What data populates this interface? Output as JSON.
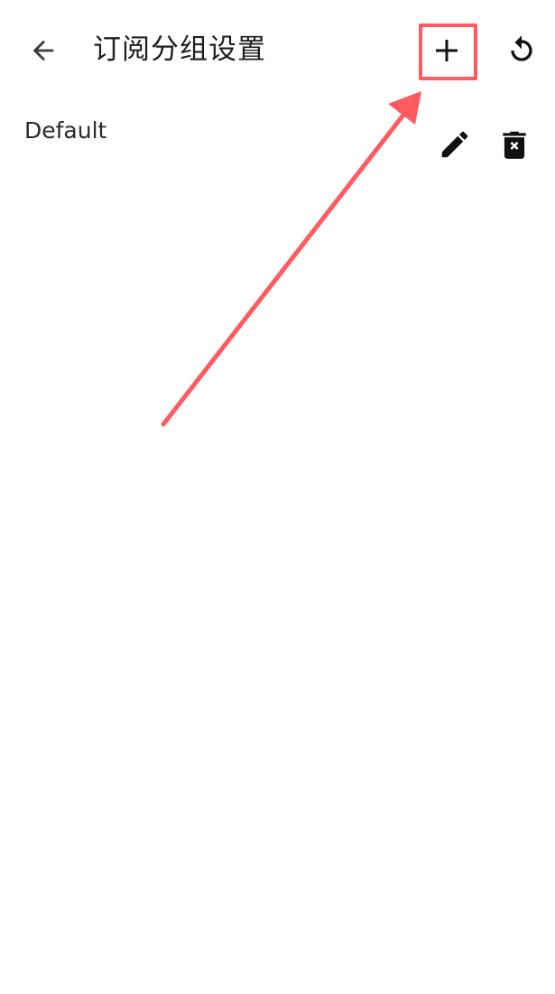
{
  "toolbar": {
    "title": "订阅分组设置",
    "back_icon": "arrow-left-icon",
    "add_icon": "plus-icon",
    "refresh_icon": "refresh-icon"
  },
  "groups": [
    {
      "name": "Default",
      "edit_icon": "pencil-icon",
      "delete_icon": "trash-icon"
    }
  ],
  "colors": {
    "annotation": "#ff5a5f",
    "text": "#1f1f1f",
    "icon": "#111111",
    "background": "#ffffff"
  }
}
